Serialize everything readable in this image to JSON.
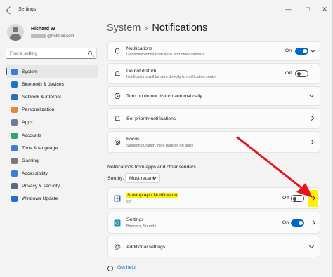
{
  "window": {
    "title": "Settings"
  },
  "user": {
    "name": "Richard W",
    "email_suffix": "@hotmail.com"
  },
  "search": {
    "placeholder": "Find a setting"
  },
  "nav": {
    "items": [
      {
        "label": "System",
        "icon": "monitor-icon",
        "color": "#3a7fd5",
        "active": true
      },
      {
        "label": "Bluetooth & devices",
        "icon": "bluetooth-icon",
        "color": "#1e73c8"
      },
      {
        "label": "Network & internet",
        "icon": "wifi-icon",
        "color": "#2c6fbb"
      },
      {
        "label": "Personalization",
        "icon": "brush-icon",
        "color": "#e08a3a"
      },
      {
        "label": "Apps",
        "icon": "apps-icon",
        "color": "#6b7d99"
      },
      {
        "label": "Accounts",
        "icon": "person-icon",
        "color": "#31a36b"
      },
      {
        "label": "Time & language",
        "icon": "globe-clock-icon",
        "color": "#3a7fd5"
      },
      {
        "label": "Gaming",
        "icon": "controller-icon",
        "color": "#7a7a7a"
      },
      {
        "label": "Accessibility",
        "icon": "accessibility-icon",
        "color": "#3a7fd5"
      },
      {
        "label": "Privacy & security",
        "icon": "shield-icon",
        "color": "#5c6b80"
      },
      {
        "label": "Windows Update",
        "icon": "refresh-icon",
        "color": "#1e73c8"
      }
    ]
  },
  "breadcrumb": {
    "parent": "System",
    "separator": "›",
    "current": "Notifications"
  },
  "settings": {
    "notifications": {
      "title": "Notifications",
      "subtitle": "Get notifications from apps and other senders",
      "state": "On"
    },
    "dnd": {
      "title": "Do not disturb",
      "subtitle": "Notifications will be sent directly to notification center",
      "state": "Off"
    },
    "auto_dnd": {
      "title": "Turn on do not disturb automatically"
    },
    "priority": {
      "title": "Set priority notifications"
    },
    "focus": {
      "title": "Focus",
      "subtitle": "Session duration, hide badges on apps"
    }
  },
  "senders": {
    "section_label": "Notifications from apps and other senders",
    "sort_label": "Sort by:",
    "sort_value": "Most recent",
    "apps": [
      {
        "title": "Startup App Notification",
        "subtitle": "Off",
        "state": "Off"
      },
      {
        "title": "Settings",
        "subtitle": "Banners, Sounds",
        "state": "On"
      }
    ]
  },
  "additional": {
    "title": "Additional settings"
  },
  "help": {
    "label": "Get help"
  },
  "colors": {
    "accent": "#0067c0",
    "highlight": "#fff200",
    "arrow": "#e8141c"
  }
}
